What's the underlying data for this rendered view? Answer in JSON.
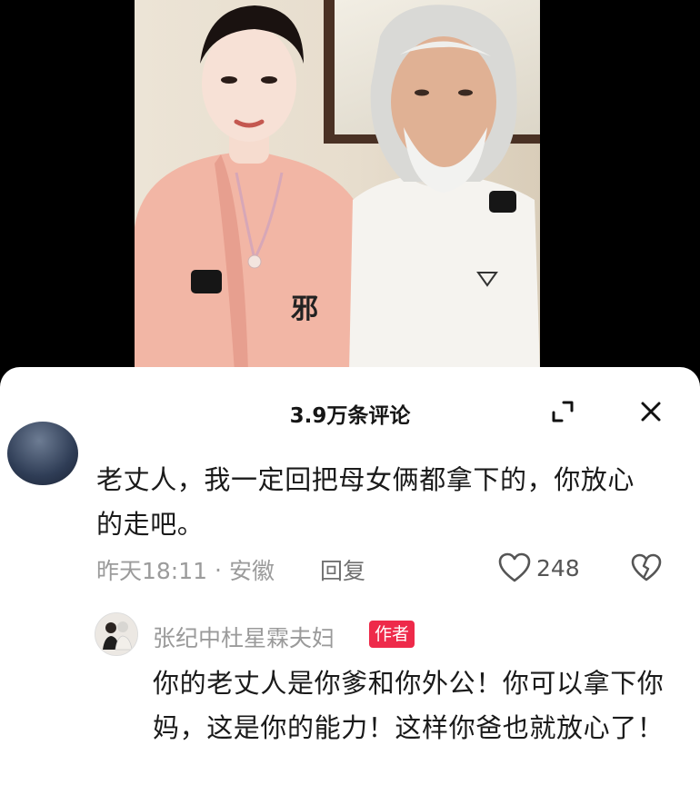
{
  "sheet": {
    "title": "3.9万条评论"
  },
  "comment": {
    "text": "老丈人，我一定回把母女俩都拿下的，你放心的走吧。",
    "time": "昨天18:11",
    "separator": "·",
    "location": "安徽",
    "reply_label": "回复",
    "like_count": "248"
  },
  "reply": {
    "author": "张纪中杜星霖夫妇",
    "badge": "作者",
    "text": "你的老丈人是你爹和你外公！你可以拿下你妈，这是你的能力！这样你爸也就放心了！"
  },
  "video": {
    "shirt_glyph": "邪"
  },
  "icons": {
    "expand": "expand-icon",
    "close": "close-icon",
    "like": "heart-icon",
    "dislike": "broken-heart-icon"
  },
  "colors": {
    "badge": "#ee2a4a",
    "meta_text": "#9b9b9b",
    "sheet_bg": "#ffffff"
  }
}
